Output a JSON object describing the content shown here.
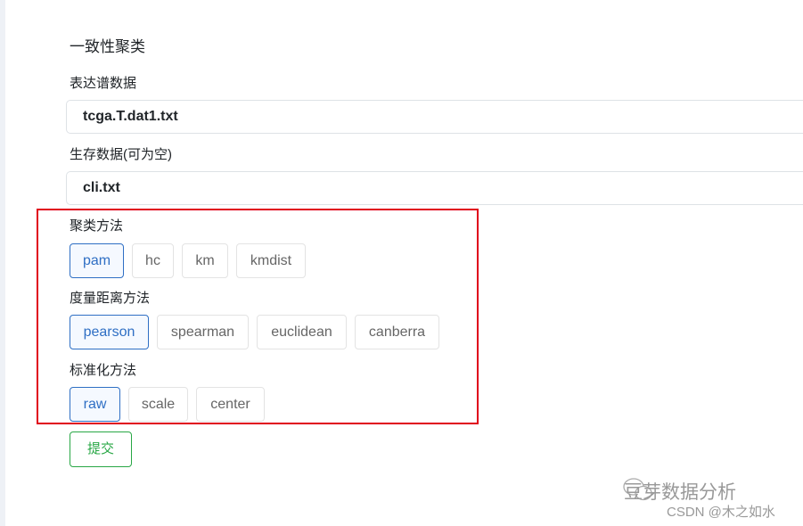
{
  "title": "一致性聚类",
  "expr": {
    "label": "表达谱数据",
    "value": "tcga.T.dat1.txt"
  },
  "surv": {
    "label": "生存数据(可为空)",
    "value": "cli.txt"
  },
  "cluster": {
    "label": "聚类方法",
    "options": [
      "pam",
      "hc",
      "km",
      "kmdist"
    ],
    "selected": "pam"
  },
  "distance": {
    "label": "度量距离方法",
    "options": [
      "pearson",
      "spearman",
      "euclidean",
      "canberra"
    ],
    "selected": "pearson"
  },
  "norm": {
    "label": "标准化方法",
    "options": [
      "raw",
      "scale",
      "center"
    ],
    "selected": "raw"
  },
  "submit": "提交",
  "watermark": {
    "line1": "豆芽数据分析",
    "line2": "CSDN @木之如水",
    "icon": "wechat-icon"
  },
  "colors": {
    "selected": "#2f6fc4",
    "submit": "#28a745",
    "highlight_box": "#e0001b"
  }
}
